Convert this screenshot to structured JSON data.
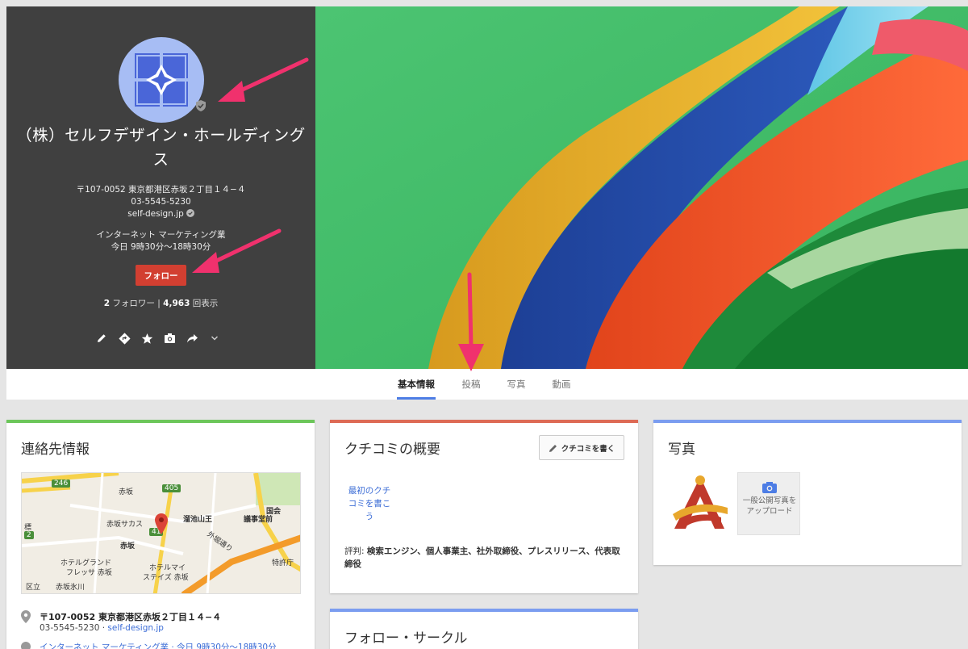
{
  "profile": {
    "name": "（株）セルフデザイン・ホールディングス",
    "address": "〒107-0052 東京都港区赤坂２丁目１４−４",
    "phone": "03-5545-5230",
    "website": "self-design.jp",
    "category": "インターネット マーケティング業",
    "hours": "今日 9時30分～18時30分",
    "follow_label": "フォロー",
    "followers_count": "2",
    "followers_label": "フォロワー",
    "views_count": "4,963",
    "views_label": "回表示"
  },
  "tabs": [
    {
      "label": "基本情報",
      "active": true
    },
    {
      "label": "投稿",
      "active": false
    },
    {
      "label": "写真",
      "active": false
    },
    {
      "label": "動画",
      "active": false
    }
  ],
  "contact": {
    "title": "連絡先情報",
    "address": "〒107-0052 東京都港区赤坂２丁目１４−４",
    "phone": "03-5545-5230",
    "separator": "·",
    "website": "self-design.jp",
    "category_hours": "インターネット マーケティング業 · 今日 9時30分～18時30分",
    "map_labels": {
      "route_246": "246",
      "akasaka": "赤坂",
      "route_405": "405",
      "akasaka_sacas": "赤坂サカス",
      "tameike_sanno": "溜池山王",
      "kokkai": "国会",
      "gijido_mae": "議事堂前",
      "route_41": "41",
      "akasaka_station": "赤坂",
      "sotobori": "外堀通り",
      "hotel_grand": "ホテルグランド",
      "fresa": "フレッサ 赤坂",
      "hotel_mystays": "ホテルマイ",
      "mystays_akasaka": "ステイズ 赤坂",
      "route_2": "2",
      "akasaka_hikawa": "赤坂氷川",
      "kuritsu": "区立",
      "tokkyocho": "特許庁",
      "tomo": "前",
      "hyo": "標"
    }
  },
  "review": {
    "title": "クチコミの概要",
    "write_label": "クチコミを書く",
    "first_review": "最初のクチコミを書こう",
    "keywords_prefix": "評判:",
    "keywords": "検索エンジン、個人事業主、社外取締役、プレスリリース、代表取締役"
  },
  "circles": {
    "title": "フォロー・サークル"
  },
  "photos": {
    "title": "写真",
    "upload_label": "一般公開写真をアップロード"
  },
  "colors": {
    "profile_bg": "#404040",
    "follow_red": "#d23f31",
    "tab_accent": "#4d7de5",
    "card_green": "#6cc65a",
    "card_red": "#dd6a55",
    "card_blue": "#7b9df0",
    "link_blue": "#3b6cd6",
    "arrow_pink": "#f0316d"
  }
}
